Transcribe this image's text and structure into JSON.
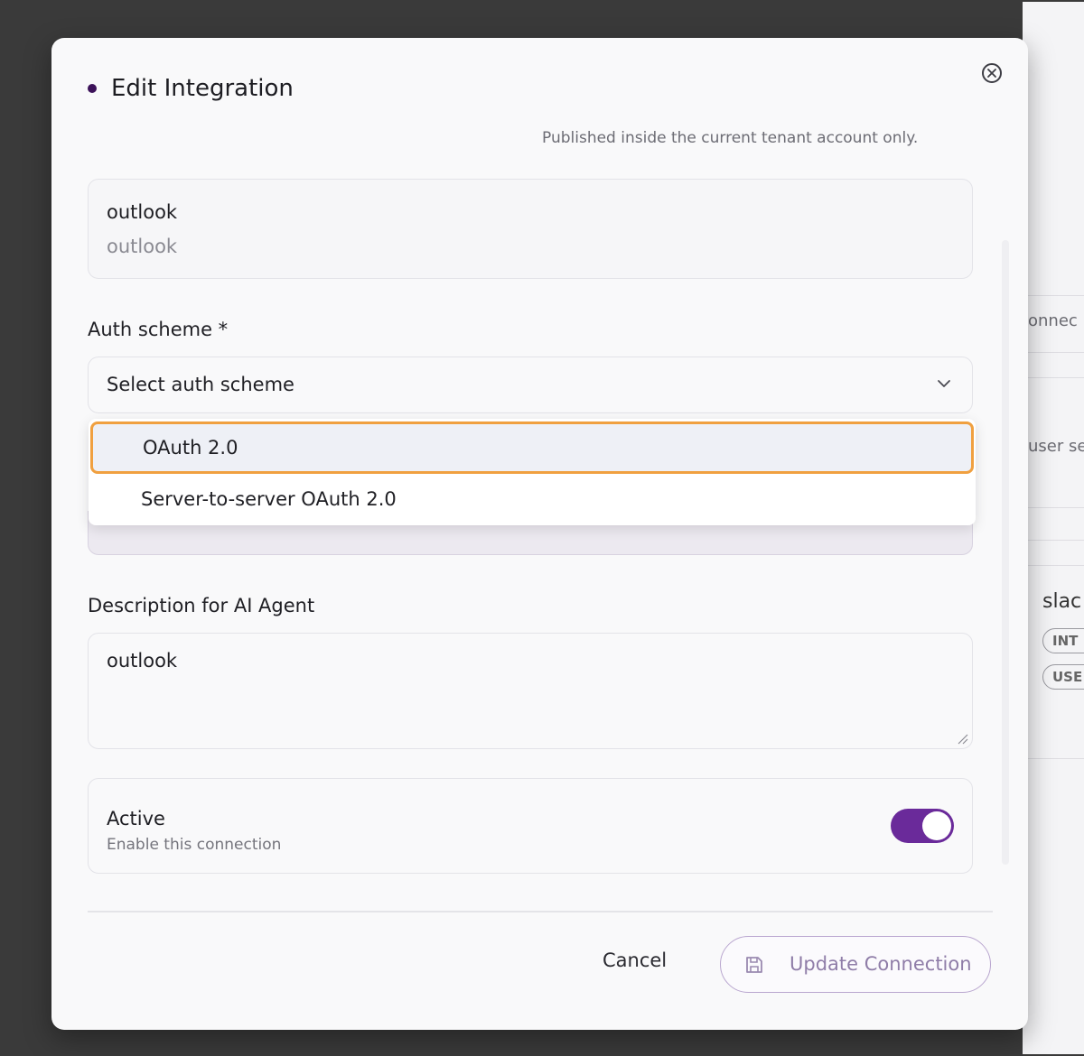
{
  "modal": {
    "title": "Edit Integration",
    "subtitle": "Published inside the current tenant account only."
  },
  "name_field": {
    "primary": "outlook",
    "secondary": "outlook"
  },
  "auth": {
    "label": "Auth scheme *",
    "placeholder": "Select auth scheme",
    "options": [
      "OAuth 2.0",
      "Server-to-server OAuth 2.0"
    ],
    "highlighted": "OAuth 2.0"
  },
  "description": {
    "label": "Description for AI Agent",
    "value": "outlook"
  },
  "active": {
    "title": "Active",
    "subtitle": "Enable this connection",
    "enabled": true
  },
  "footer": {
    "cancel": "Cancel",
    "update": "Update Connection"
  },
  "background": {
    "connect_fragment": "onnec",
    "user_fragment": "user se",
    "slack_fragment": "slac",
    "pill1": "INT",
    "pill2": "USE"
  },
  "colors": {
    "accent": "#6a2a9a",
    "highlight_border": "#f0a040"
  }
}
